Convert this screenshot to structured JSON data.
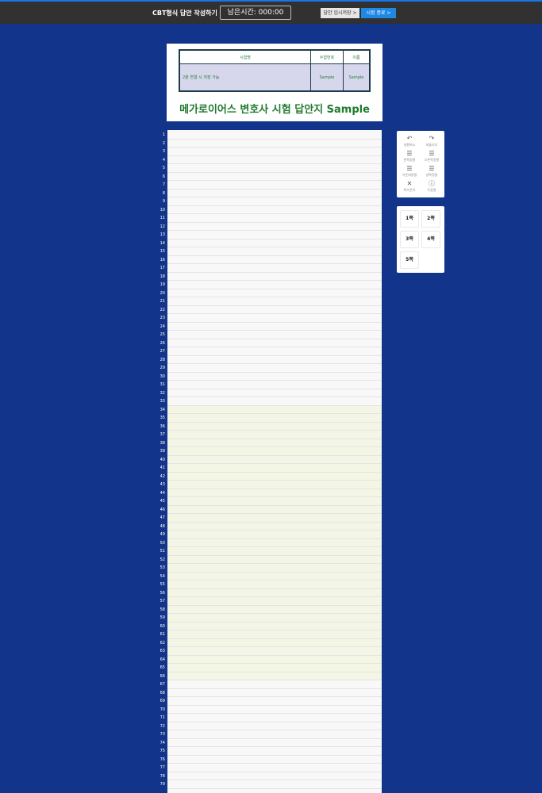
{
  "topbar": {
    "title": "CBT형식 답안 작성하기",
    "timer_label": "남은시간: 000:00",
    "save_label": "답안 임시저장 >",
    "end_label": "시험 종료 >"
  },
  "header": {
    "columns": [
      "시험명",
      "수험번호",
      "이름"
    ],
    "row": {
      "subject": "2분 연결 시 저장 가능",
      "exam_number": "Sample",
      "name": "Sample"
    },
    "title": "메가로이어스 변호사 시험 답안지 Sample"
  },
  "answer_sheet": {
    "line_count": 79,
    "visible_line_numbers": [
      "1",
      "2",
      "3",
      "4",
      "5",
      "6",
      "7",
      "8",
      "9",
      "10",
      "11",
      "12",
      "13",
      "14",
      "15",
      "16",
      "17",
      "18",
      "19",
      "20",
      "21",
      "22",
      "23",
      "24",
      "25",
      "26",
      "27",
      "28",
      "29",
      "30",
      "31",
      "32",
      "33",
      "34",
      "35",
      "36",
      "37",
      "38",
      "39",
      "40",
      "41",
      "42",
      "43",
      "44",
      "45",
      "46",
      "47",
      "48",
      "49",
      "50",
      "51",
      "52",
      "53",
      "54",
      "55",
      "56",
      "57",
      "58",
      "59",
      "60",
      "61",
      "62",
      "63",
      "64",
      "65",
      "66",
      "67",
      "68",
      "69",
      "70",
      "71",
      "72",
      "73",
      "74",
      "75",
      "76",
      "77",
      "78",
      "79"
    ],
    "highlight_range": [
      34,
      66
    ],
    "highlight_color": "#f3f6e4"
  },
  "tools": [
    {
      "icon": "undo-icon",
      "label": "실행취소"
    },
    {
      "icon": "redo-icon",
      "label": "되돌리기"
    },
    {
      "icon": "align-left-icon",
      "label": "왼쪽정렬"
    },
    {
      "icon": "align-right-icon",
      "label": "오른쪽정렬"
    },
    {
      "icon": "align-center-icon",
      "label": "가운데정렬"
    },
    {
      "icon": "align-justify-icon",
      "label": "양쪽정렬"
    },
    {
      "icon": "special-char-icon",
      "label": "특수문자"
    },
    {
      "icon": "help-icon",
      "label": "도움말"
    }
  ],
  "pages": [
    "1쪽",
    "2쪽",
    "3쪽",
    "4쪽",
    "5쪽"
  ],
  "colors": {
    "background": "#12348a",
    "topbar": "#313131",
    "accent": "#1e88e5",
    "title_green": "#1f7a2e"
  }
}
